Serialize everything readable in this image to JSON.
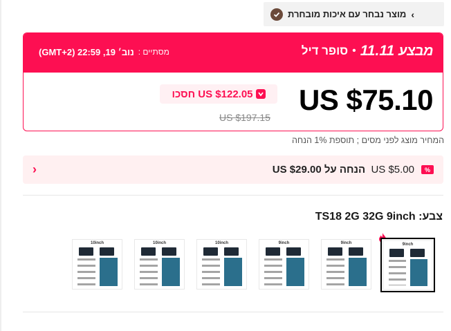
{
  "choice_badge": {
    "text": "מוצר נבחר עם איכות מובחרת",
    "chevron": "›",
    "icon": "check-badge-icon"
  },
  "deal": {
    "brand": "מבצע",
    "brand_number": "11.11",
    "dot": "•",
    "deal_name": "סופר דיל",
    "timer_label": "מסתיים :",
    "timer_value": "נוב׳ 19, 22:59 (GMT+2)",
    "current_price": "US $75.10",
    "save_text": "US $122.05 חסכו",
    "original_price": "US $197.15"
  },
  "tax_note": "המחיר מוצג לפני מסים ; תוספת 1% הנחה",
  "coupon": {
    "icon_text": "%",
    "discount": "US $5.00",
    "condition": "הנחה על US $29.00",
    "chevron": "‹"
  },
  "color": {
    "label": "צבע: TS18 2G 32G 9inch"
  },
  "thumbnails": [
    {
      "caption": "9inch",
      "selected": true,
      "hot": true
    },
    {
      "caption": "9inch",
      "selected": false
    },
    {
      "caption": "9inch",
      "selected": false
    },
    {
      "caption": "10inch",
      "selected": false
    },
    {
      "caption": "10inch",
      "selected": false
    },
    {
      "caption": "10inch",
      "selected": false
    }
  ],
  "colors": {
    "accent": "#fd0f52",
    "coupon_bg": "#fff0f1",
    "badge_bg": "#f2f2f2"
  }
}
